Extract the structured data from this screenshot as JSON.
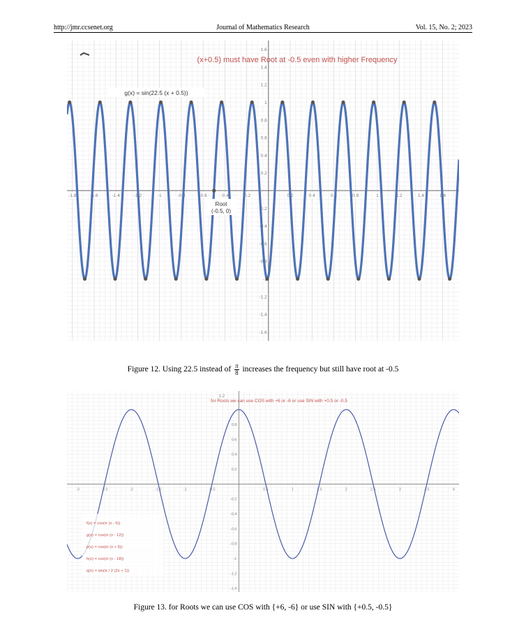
{
  "header": {
    "url": "http://jmr.ccsenet.org",
    "journal": "Journal of Mathematics Research",
    "volume": "Vol. 15, No. 2; 2023"
  },
  "figure12": {
    "annotation": "(x+0.5) must have Root at -0.5 even with higher Frequency",
    "function_label": "g(x) = sin(22.5 (x + 0.5))",
    "root_label_line1": "Root",
    "root_label_line2": "(-0.5, 0)",
    "caption_before": "Figure 12. Using 22.5 instead of ",
    "caption_frac_num": "π",
    "caption_frac_den": "8",
    "caption_after": " increases the frequency but still have root at -0.5",
    "colors": {
      "curve": "#4f73b6",
      "annotation": "#c0504d",
      "grid": "#d9d9d9",
      "point": "#555555"
    },
    "x_ticks": [
      "-1.8",
      "-1.6",
      "-1.4",
      "-1.2",
      "-1",
      "-0.8",
      "-0.6",
      "-0.4",
      "-0.2",
      "0",
      "0.2",
      "0.4",
      "0.6",
      "0.8",
      "1",
      "1.2",
      "1.4",
      "1.6"
    ],
    "y_ticks_pos": [
      "1.6",
      "1.4",
      "1.2",
      "1",
      "0.8",
      "0.6",
      "0.4",
      "0.2"
    ],
    "y_ticks_neg": [
      "-0.2",
      "-0.4",
      "-0.6",
      "-0.8",
      "-1",
      "-1.2",
      "-1.4",
      "-1.6"
    ],
    "chart_data": {
      "type": "line",
      "series": [
        {
          "name": "g(x) = sin(22.5 (x + 0.5))",
          "function": "sin(22.5*(x+0.5))"
        }
      ],
      "xlim": [
        -1.85,
        1.75
      ],
      "ylim": [
        -1.7,
        1.7
      ],
      "points": [
        {
          "x": -0.5,
          "y": 0,
          "label": "Root (-0.5, 0)"
        }
      ],
      "grid": true
    }
  },
  "figure13": {
    "annotation": "for Roots we can use COS with +6 or -6 or use SIN with +0.5 or -0.5",
    "top_tick": "1.2",
    "legend": [
      "f(x) = cos(π (x - 6))",
      "g(x) = cos(π (x - 12))",
      "p(x) = cos(π (x + 6))",
      "h(x) = cos(π (x - 18))",
      "q(x) = sin(π / 2 (2x + 1))"
    ],
    "caption": "Figure 13. for Roots we can use COS with {+6, -6} or use SIN with {+0.5, -0.5}",
    "colors": {
      "curve": "#4a5aa8",
      "annotation": "#c0504d",
      "legend": "#c0504d",
      "grid": "#dcdcdc"
    },
    "x_ticks": [
      "-3",
      "-2.5",
      "-2",
      "-1.5",
      "-1",
      "-0.5",
      "0",
      "0.5",
      "1",
      "1.5",
      "2",
      "2.5",
      "3",
      "3.5",
      "4"
    ],
    "y_ticks": [
      "0.8",
      "0.6",
      "0.4",
      "0.2",
      "0",
      "-0.2",
      "-0.4",
      "-0.6",
      "-0.8",
      "-1",
      "-1.2",
      "-1.4"
    ],
    "chart_data": {
      "type": "line",
      "series": [
        {
          "name": "q(x) = sin(π / 2 (2x + 1))",
          "function": "cos(pi*x)"
        }
      ],
      "xlim": [
        -3.2,
        4.1
      ],
      "ylim": [
        -1.45,
        1.25
      ],
      "grid": true
    }
  }
}
